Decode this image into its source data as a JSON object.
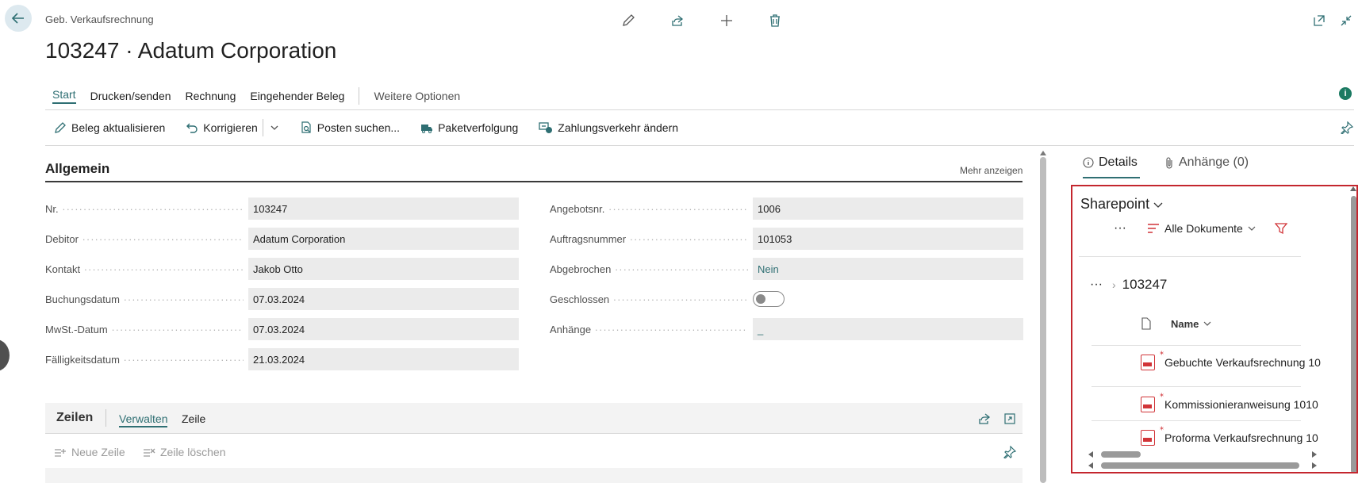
{
  "header": {
    "breadcrumb": "Geb. Verkaufsrechnung",
    "title": "103247 · Adatum Corporation"
  },
  "tabs": [
    {
      "label": "Start"
    },
    {
      "label": "Drucken/senden"
    },
    {
      "label": "Rechnung"
    },
    {
      "label": "Eingehender Beleg"
    },
    {
      "label": "Weitere Optionen"
    }
  ],
  "actions": [
    {
      "label": "Beleg aktualisieren"
    },
    {
      "label": "Korrigieren"
    },
    {
      "label": "Posten suchen..."
    },
    {
      "label": "Paketverfolgung"
    },
    {
      "label": "Zahlungsverkehr ändern"
    }
  ],
  "general": {
    "title": "Allgemein",
    "more": "Mehr anzeigen",
    "left": [
      {
        "label": "Nr.",
        "value": "103247"
      },
      {
        "label": "Debitor",
        "value": "Adatum Corporation"
      },
      {
        "label": "Kontakt",
        "value": "Jakob Otto"
      },
      {
        "label": "Buchungsdatum",
        "value": "07.03.2024"
      },
      {
        "label": "MwSt.-Datum",
        "value": "07.03.2024"
      },
      {
        "label": "Fälligkeitsdatum",
        "value": "21.03.2024"
      }
    ],
    "right": [
      {
        "label": "Angebotsnr.",
        "value": "1006"
      },
      {
        "label": "Auftragsnummer",
        "value": "101053"
      },
      {
        "label": "Abgebrochen",
        "value": "Nein"
      },
      {
        "label": "Geschlossen",
        "value": false
      },
      {
        "label": "Anhänge",
        "value": "_"
      }
    ]
  },
  "lines": {
    "title": "Zeilen",
    "tabs": [
      "Verwalten",
      "Zeile"
    ],
    "actions": [
      "Neue Zeile",
      "Zeile löschen"
    ]
  },
  "factbox": {
    "tabs": [
      {
        "label": "Details"
      },
      {
        "label": "Anhänge (0)"
      }
    ],
    "sharepoint": {
      "title": "Sharepoint",
      "view": "Alle Dokumente",
      "folder": "103247",
      "column": "Name",
      "files": [
        "Gebuchte Verkaufsrechnung 10",
        "Kommissionieranweisung 1010",
        "Proforma Verkaufsrechnung 10"
      ]
    }
  },
  "colors": {
    "accent": "#2f6f73",
    "highlight": "#c4262e",
    "pdf": "#d13438"
  }
}
